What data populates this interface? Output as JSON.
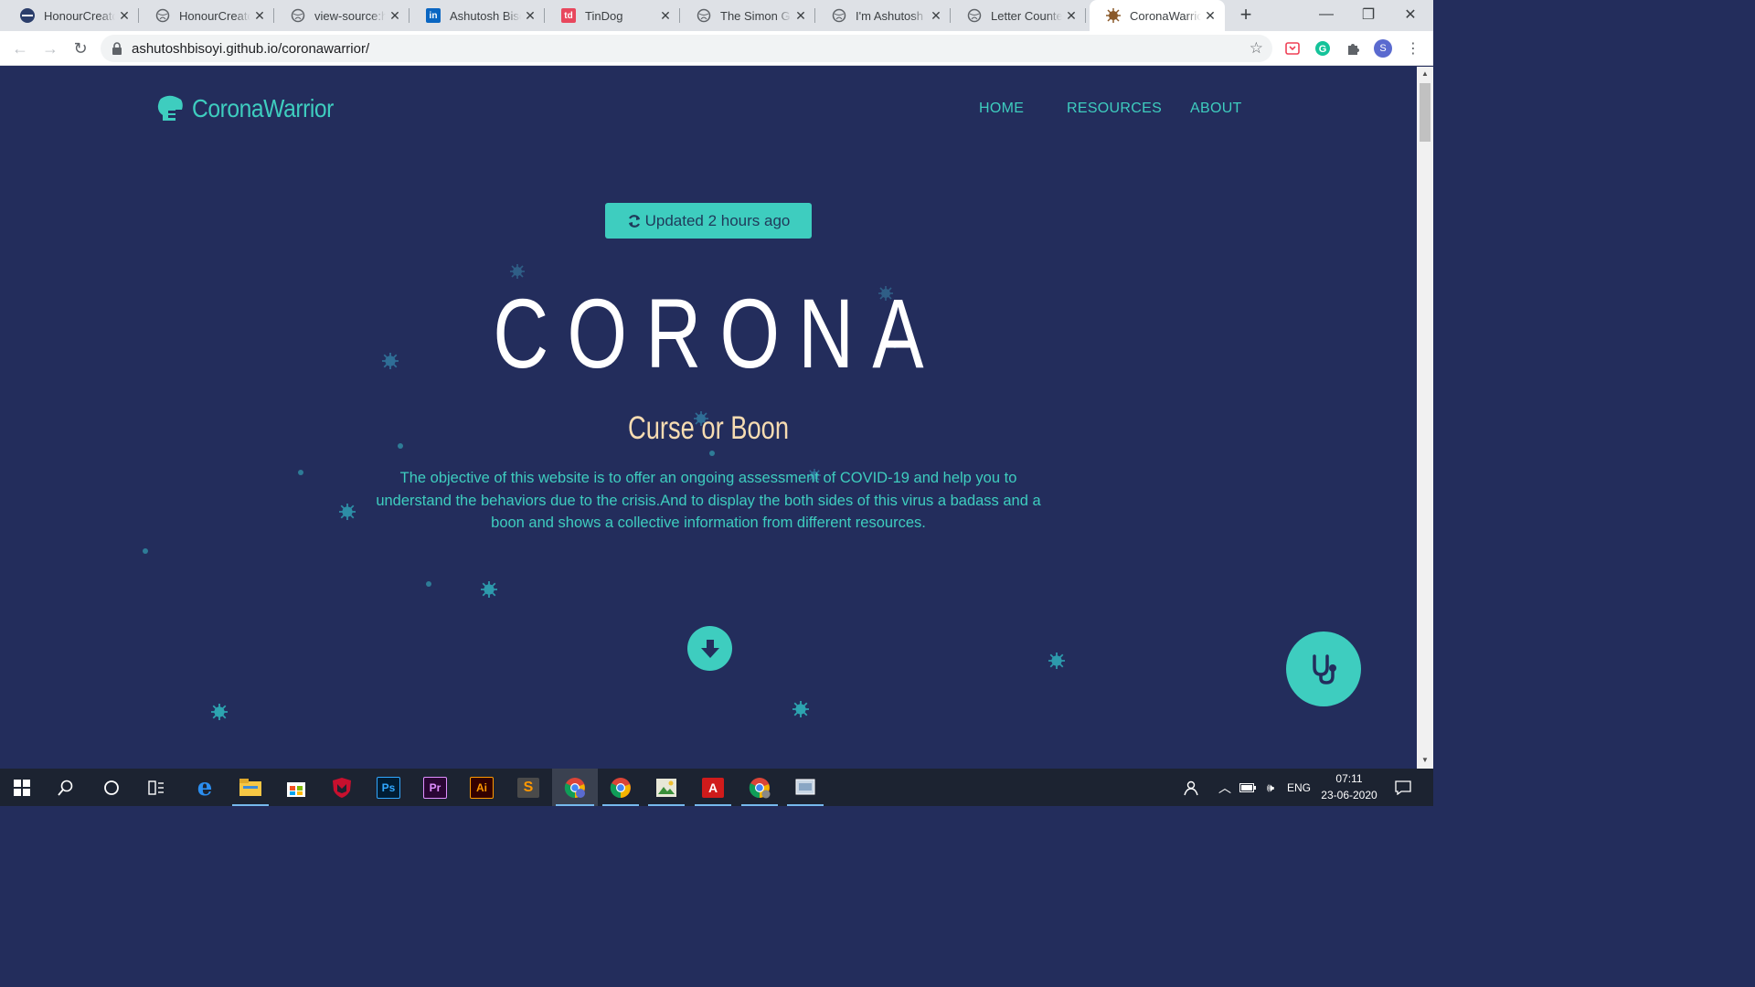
{
  "browser": {
    "tabs": [
      {
        "title": "HonourCreator",
        "icon": "site-globe-icon",
        "active": false
      },
      {
        "title": "HonourCreator",
        "icon": "globe-icon",
        "active": false
      },
      {
        "title": "view-source:https",
        "icon": "globe-icon",
        "active": false
      },
      {
        "title": "Ashutosh Bisoyi",
        "icon": "linkedin-icon",
        "active": false
      },
      {
        "title": "TinDog",
        "icon": "td-icon",
        "active": false
      },
      {
        "title": "The Simon Game",
        "icon": "globe-icon",
        "active": false
      },
      {
        "title": "I'm Ashutosh",
        "icon": "globe-icon",
        "active": false
      },
      {
        "title": "Letter Counter",
        "icon": "globe-icon",
        "active": false
      },
      {
        "title": "CoronaWarrior",
        "icon": "virus-favicon-icon",
        "active": true
      }
    ],
    "url": "ashutoshbisoyi.github.io/coronawarrior/",
    "profile_initial": "S"
  },
  "site": {
    "brand": "CoronaWarrior",
    "nav": {
      "home": "HOME",
      "resources": "RESOURCES",
      "about": "ABOUT"
    },
    "update_label": "Updated 2 hours ago",
    "title": "CORONA",
    "subtitle": "Curse or Boon",
    "description": "The objective of this website is to offer an ongoing assessment of COVID-19 and help you to understand the behaviors due to the crisis.And to display the both sides of this virus a badass and a boon and shows a collective information from different resources.",
    "colors": {
      "background": "#232d5c",
      "accent": "#3ecdbf",
      "subtitle": "#f7dcb2",
      "title": "#ffffff"
    }
  },
  "taskbar": {
    "language": "ENG",
    "time": "07:11",
    "date": "23-06-2020",
    "apps": [
      "start",
      "search",
      "cortana",
      "task-view",
      "edge",
      "file-explorer",
      "store",
      "mcafee",
      "photoshop",
      "premiere",
      "illustrator",
      "sublime",
      "chrome-profile",
      "chrome",
      "photos",
      "acrobat",
      "chrome-alt",
      "app-window"
    ],
    "app_labels": {
      "photoshop": "Ps",
      "premiere": "Pr",
      "illustrator": "Ai",
      "sublime": "S",
      "acrobat": "A"
    }
  }
}
